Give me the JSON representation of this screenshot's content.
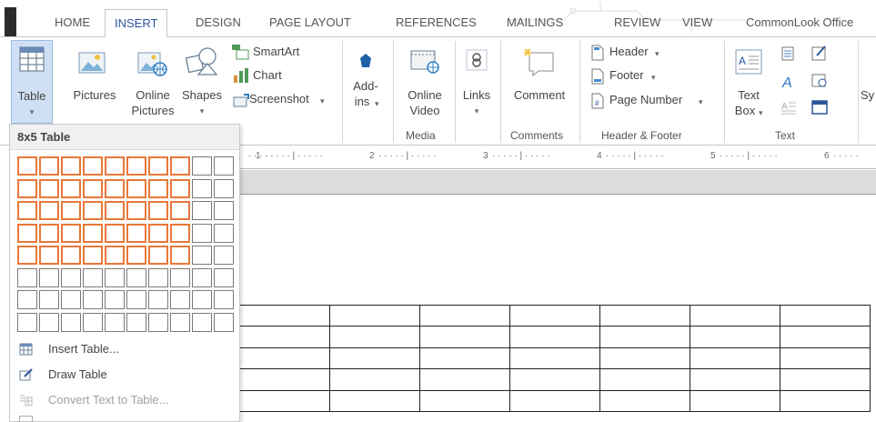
{
  "tabs": [
    {
      "label": "HOME"
    },
    {
      "label": "INSERT"
    },
    {
      "label": "DESIGN"
    },
    {
      "label": "PAGE LAYOUT"
    },
    {
      "label": "REFERENCES"
    },
    {
      "label": "MAILINGS"
    },
    {
      "label": "REVIEW"
    },
    {
      "label": "VIEW"
    },
    {
      "label": "CommonLook Office"
    }
  ],
  "ribbon": {
    "table": {
      "label": "Table",
      "arrow": "▾"
    },
    "pictures": {
      "label": "Pictures"
    },
    "online_pictures": {
      "label_1": "Online",
      "label_2": "Pictures"
    },
    "shapes": {
      "label": "Shapes",
      "arrow": "▾"
    },
    "smartart": {
      "label": "SmartArt"
    },
    "chart": {
      "label": "Chart"
    },
    "screenshot": {
      "label": "Screenshot",
      "arrow": "▾"
    },
    "addins": {
      "label_1": "Add-",
      "label_2": "ins",
      "arrow": "▾"
    },
    "online_video": {
      "label_1": "Online",
      "label_2": "Video"
    },
    "links": {
      "label": "Links",
      "arrow": "▾"
    },
    "comment": {
      "label": "Comment"
    },
    "header": {
      "label": "Header",
      "arrow": "▾"
    },
    "footer": {
      "label": "Footer",
      "arrow": "▾"
    },
    "page_number": {
      "label": "Page Number",
      "arrow": "▾"
    },
    "text_box": {
      "label_1": "Text",
      "label_2": "Box",
      "arrow": "▾"
    },
    "symbols_partial": "Sy",
    "groups": {
      "media": "Media",
      "comments": "Comments",
      "header_footer": "Header & Footer",
      "text": "Text"
    }
  },
  "ruler": {
    "marks": [
      "1",
      "2",
      "3",
      "4",
      "5",
      "6"
    ]
  },
  "dropdown": {
    "header": "8x5 Table",
    "grid_columns": 10,
    "grid_rows": 8,
    "selected_columns": 8,
    "selected_rows": 5,
    "items": [
      {
        "label": "Insert Table...",
        "icon": "insert-table-icon",
        "enabled": true
      },
      {
        "label": "Draw Table",
        "icon": "draw-table-icon",
        "enabled": true
      },
      {
        "label": "Convert Text to Table...",
        "icon": "convert-text-icon",
        "enabled": false
      }
    ]
  },
  "document_table": {
    "columns": 7,
    "rows": 5
  },
  "colors": {
    "accent": "#2b579a",
    "highlight": "#e8783a",
    "grid_border": "#7a7a7a"
  }
}
